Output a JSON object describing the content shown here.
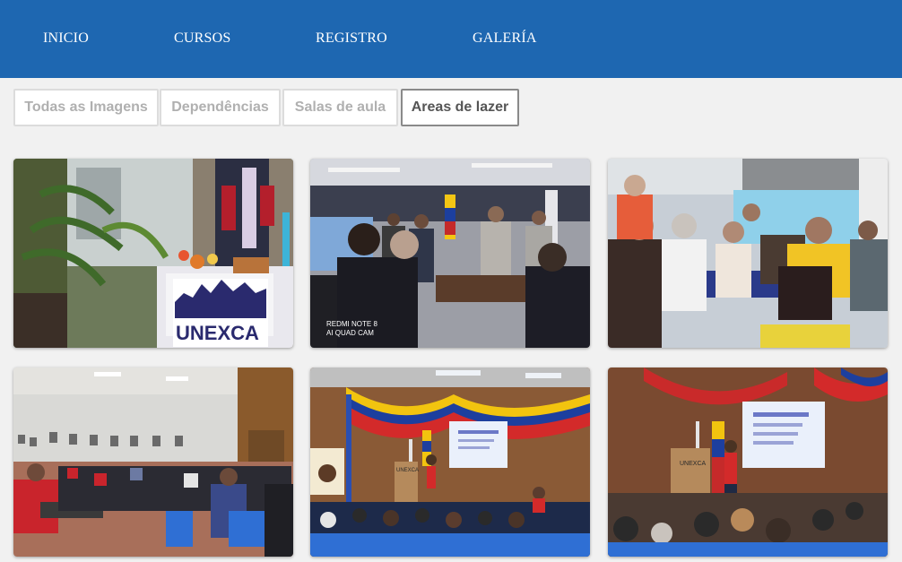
{
  "nav": {
    "items": [
      {
        "label": "INICIO"
      },
      {
        "label": "CURSOS"
      },
      {
        "label": "REGISTRO"
      },
      {
        "label": "GALERÍA"
      }
    ]
  },
  "filters": {
    "buttons": [
      {
        "label": "Todas as Imagens"
      },
      {
        "label": "Dependências"
      },
      {
        "label": "Salas de aula"
      },
      {
        "label": "Areas de lazer",
        "active": true
      }
    ]
  },
  "gallery": {
    "photo_1": {
      "banner_text": "UNEXCA"
    },
    "photo_2": {
      "watermark_line1": "REDMI NOTE 8",
      "watermark_line2": "AI QUAD CAM"
    },
    "photo_5": {
      "podium_text": "UNEXCA"
    },
    "photo_6": {
      "podium_text": "UNEXCA"
    }
  },
  "colors": {
    "navbar": "#1e67b1",
    "page_background": "#f1f1f1",
    "active_filter_border": "#8a8a8a"
  }
}
